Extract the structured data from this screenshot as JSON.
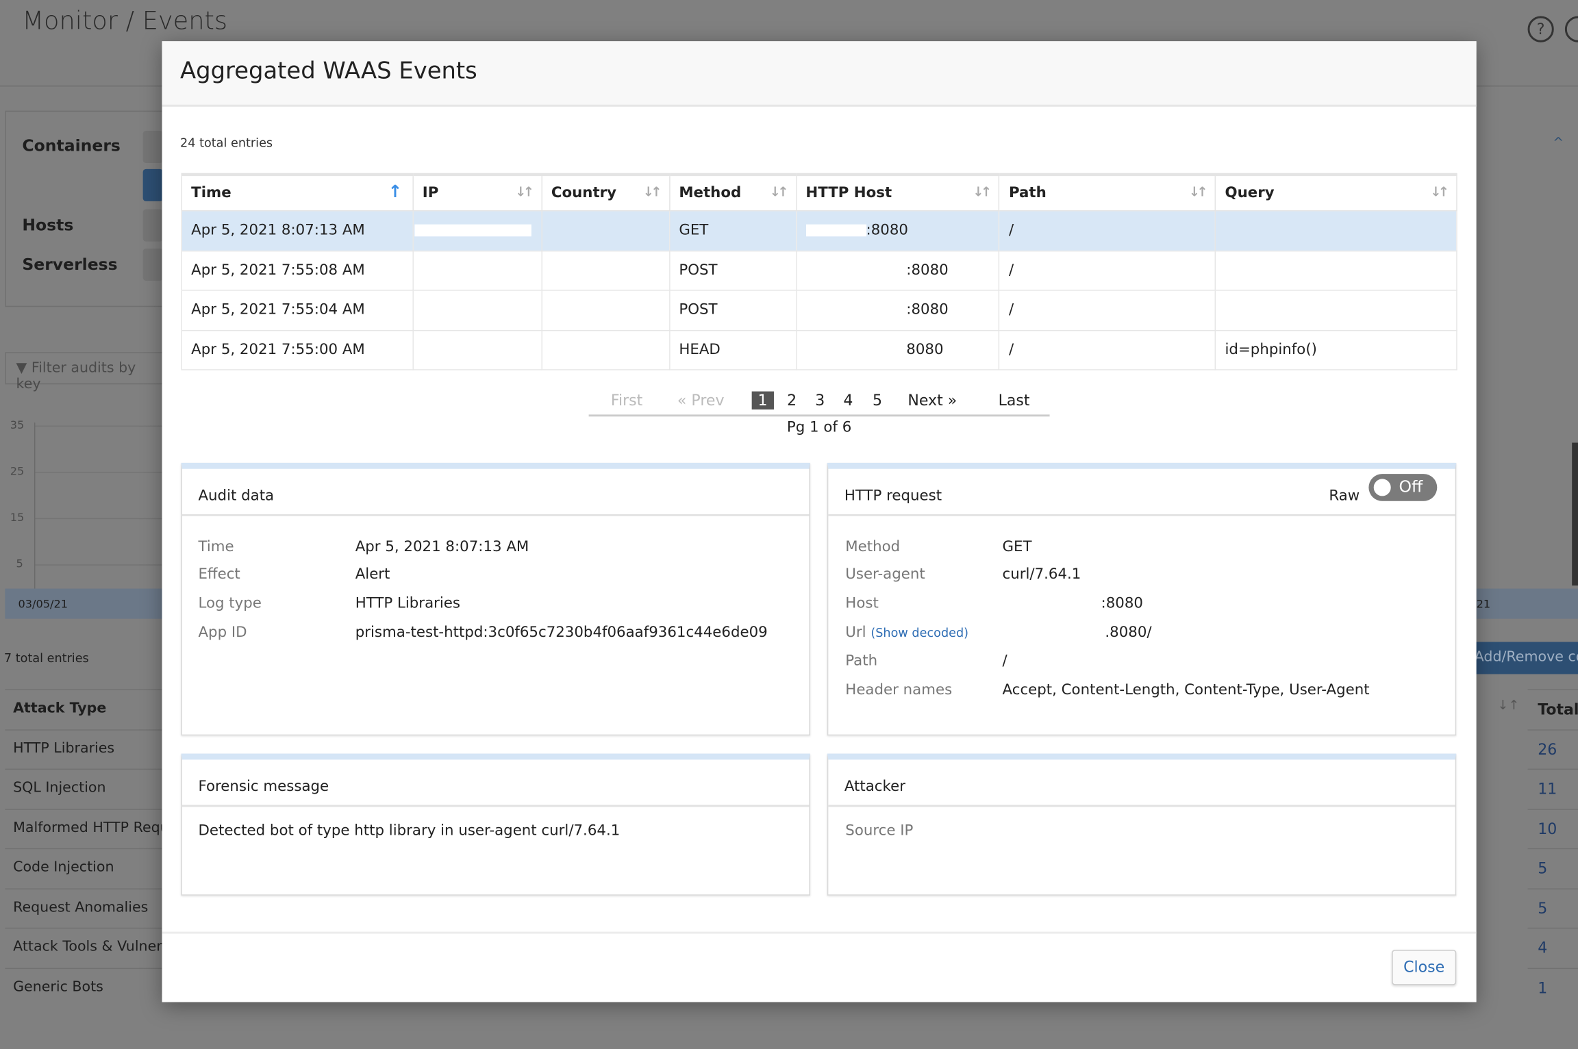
{
  "background": {
    "title": "Monitor / Events",
    "left_panel": [
      "Containers",
      "Hosts",
      "Serverless"
    ],
    "filter_placeholder": "Filter audits by key",
    "chart_ticks": [
      "35",
      "25",
      "15",
      "5"
    ],
    "x_label_left": "03/05/21",
    "x_label_right": "21",
    "total_entries": "7 total entries",
    "add_remove": "Add/Remove co",
    "attack_header": "Attack Type",
    "total_header": "Total",
    "attack_rows": [
      {
        "type": "HTTP Libraries",
        "total": "26"
      },
      {
        "type": "SQL Injection",
        "total": "11"
      },
      {
        "type": "Malformed HTTP Requ",
        "total": "10"
      },
      {
        "type": "Code Injection",
        "total": "5"
      },
      {
        "type": "Request Anomalies",
        "total": "5"
      },
      {
        "type": "Attack Tools & Vulnera",
        "total": "4"
      },
      {
        "type": "Generic Bots",
        "total": "1"
      }
    ]
  },
  "modal": {
    "title": "Aggregated WAAS Events",
    "total_entries": "24 total entries",
    "columns": [
      "Time",
      "IP",
      "Country",
      "Method",
      "HTTP Host",
      "Path",
      "Query"
    ],
    "rows": [
      {
        "time": "Apr 5, 2021 8:07:13 AM",
        "ip": "",
        "country": "",
        "method": "GET",
        "host": ":8080",
        "path": "/",
        "query": ""
      },
      {
        "time": "Apr 5, 2021 7:55:08 AM",
        "ip": "",
        "country": "",
        "method": "POST",
        "host": ":8080",
        "path": "/",
        "query": ""
      },
      {
        "time": "Apr 5, 2021 7:55:04 AM",
        "ip": "",
        "country": "",
        "method": "POST",
        "host": ":8080",
        "path": "/",
        "query": ""
      },
      {
        "time": "Apr 5, 2021 7:55:00 AM",
        "ip": "",
        "country": "",
        "method": "HEAD",
        "host": "8080",
        "path": "/",
        "query": "id=phpinfo()"
      }
    ],
    "pagination": {
      "first": "First",
      "prev": "Prev",
      "pages": [
        "1",
        "2",
        "3",
        "4",
        "5"
      ],
      "current": "1",
      "next": "Next",
      "last": "Last",
      "info": "Pg 1 of 6"
    },
    "audit": {
      "title": "Audit data",
      "items": [
        {
          "label": "Time",
          "value": "Apr 5, 2021 8:07:13 AM"
        },
        {
          "label": "Effect",
          "value": "Alert"
        },
        {
          "label": "Log type",
          "value": "HTTP Libraries"
        },
        {
          "label": "App ID",
          "value": "prisma-test-httpd:3c0f65c7230b4f06aaf9361c44e6de09"
        }
      ]
    },
    "http": {
      "title": "HTTP request",
      "raw_label": "Raw",
      "raw_state": "Off",
      "show_decoded": "(Show decoded)",
      "items": [
        {
          "label": "Method",
          "value": "GET"
        },
        {
          "label": "User-agent",
          "value": "curl/7.64.1"
        },
        {
          "label": "Host",
          "value": ":8080"
        },
        {
          "label": "Url",
          "value": ".8080/"
        },
        {
          "label": "Path",
          "value": "/"
        },
        {
          "label": "Header names",
          "value": "Accept, Content-Length, Content-Type, User-Agent"
        }
      ]
    },
    "forensic": {
      "title": "Forensic message",
      "message": "Detected bot of type http library in user-agent curl/7.64.1"
    },
    "attacker": {
      "title": "Attacker",
      "source_ip_label": "Source IP"
    },
    "close": "Close"
  }
}
